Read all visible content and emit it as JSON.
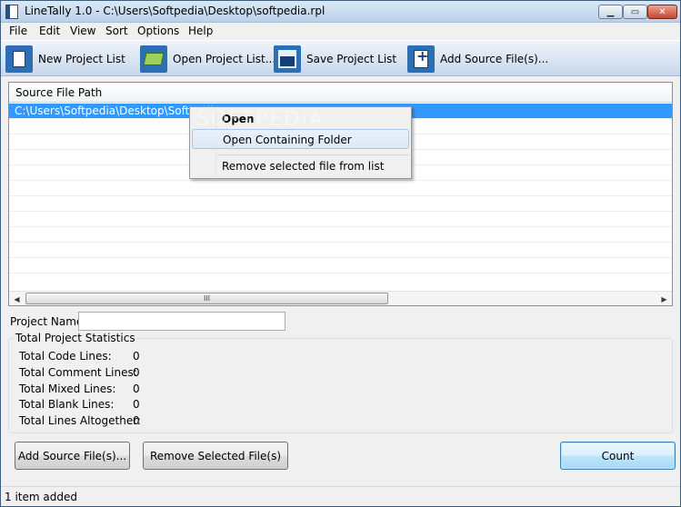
{
  "window": {
    "title": "LineTally 1.0 - C:\\Users\\Softpedia\\Desktop\\softpedia.rpl",
    "min_glyph": "▁",
    "max_glyph": "▭",
    "close_glyph": "✕"
  },
  "menubar": {
    "items": [
      {
        "label": "File"
      },
      {
        "label": "Edit"
      },
      {
        "label": "View"
      },
      {
        "label": "Sort"
      },
      {
        "label": "Options"
      },
      {
        "label": "Help"
      }
    ]
  },
  "toolbar": {
    "buttons": [
      {
        "label": "New Project List",
        "icon": "new-document-icon"
      },
      {
        "label": "Open Project List...",
        "icon": "open-folder-icon"
      },
      {
        "label": "Save Project List",
        "icon": "save-disk-icon"
      },
      {
        "label": "Add Source File(s)...",
        "icon": "add-file-icon"
      }
    ]
  },
  "file_list": {
    "column_header": "Source File Path",
    "rows": [
      {
        "path": "C:\\Users\\Softpedia\\Desktop\\Softpedia.",
        "selected": true
      }
    ],
    "scroll_thumb_glyph": "III",
    "scroll_left_glyph": "◀",
    "scroll_right_glyph": "▶"
  },
  "context_menu": {
    "items": [
      {
        "label": "Open",
        "bold": true
      },
      {
        "label": "Open Containing Folder",
        "hover": true
      },
      {
        "label": "Remove selected file from list"
      }
    ]
  },
  "watermark": "SOFTPEDIA",
  "project": {
    "name_label": "Project Name:",
    "name_value": ""
  },
  "stats": {
    "title": "Total Project Statistics",
    "rows": [
      {
        "label": "Total Code Lines:",
        "value": "0"
      },
      {
        "label": "Total Comment Lines:",
        "value": "0"
      },
      {
        "label": "Total Mixed Lines:",
        "value": "0"
      },
      {
        "label": "Total Blank Lines:",
        "value": "0"
      },
      {
        "label": "Total Lines Altogether:",
        "value": "0"
      }
    ]
  },
  "buttons": {
    "add_source": "Add Source File(s)...",
    "remove_selected": "Remove Selected File(s)",
    "count": "Count"
  },
  "statusbar": {
    "text": "1 item added"
  }
}
